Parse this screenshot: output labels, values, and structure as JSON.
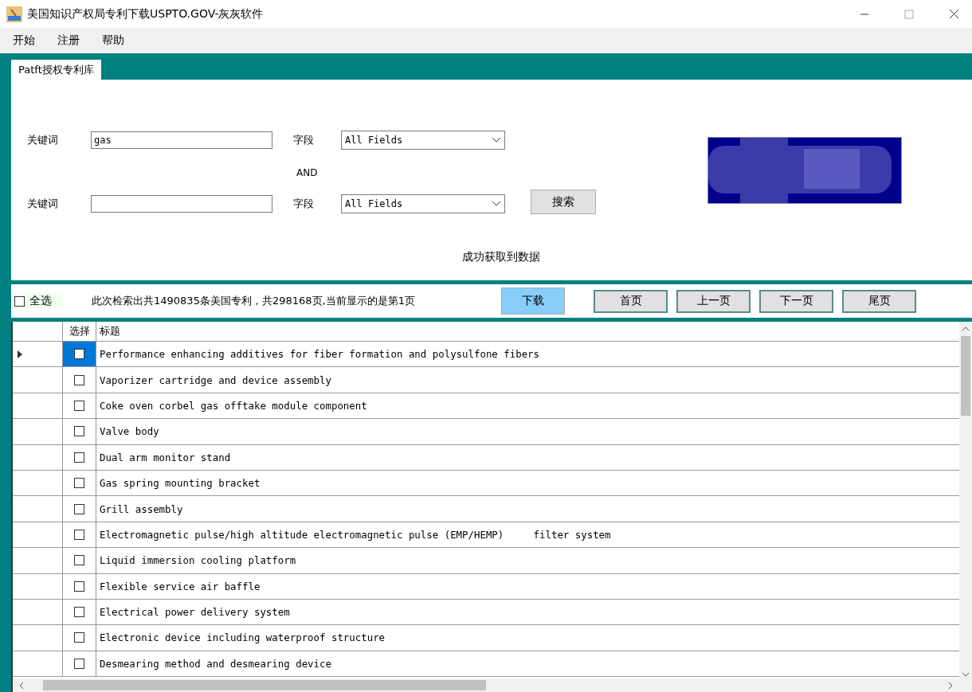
{
  "window": {
    "title": "美国知识产权局专利下载USPTO.GOV-灰灰软件"
  },
  "menu": [
    "开始",
    "注册",
    "帮助"
  ],
  "tabs": [
    {
      "label": "Patft授权专利库",
      "selected": true
    }
  ],
  "search": {
    "rows": [
      {
        "label": "关键词",
        "value": "gas",
        "field_label": "字段",
        "field": "All Fields"
      },
      {
        "label": "关键词",
        "field_label": "字段",
        "field": "All Fields"
      }
    ],
    "operator": "AND",
    "button": "搜索",
    "status": "成功获取到数据"
  },
  "toolbar": {
    "select_all": {
      "label": "全选",
      "checked": false
    },
    "summary": "此次检索出共1490835条美国专利，共298168页,当前显示的是第1页",
    "download": "下载",
    "pager": [
      "首页",
      "上一页",
      "下一页",
      "尾页"
    ]
  },
  "table": {
    "columns": [
      "选择",
      "标题"
    ],
    "rows": [
      {
        "title": "Performance enhancing additives for fiber formation and polysulfone fibers",
        "checked": false,
        "selected": true
      },
      {
        "title": "Vaporizer cartridge and device assembly",
        "checked": false,
        "selected": false
      },
      {
        "title": "Coke oven corbel gas offtake module component",
        "checked": false,
        "selected": false
      },
      {
        "title": "Valve body",
        "checked": false,
        "selected": false
      },
      {
        "title": "Dual arm monitor stand",
        "checked": false,
        "selected": false
      },
      {
        "title": "Gas spring mounting bracket",
        "checked": false,
        "selected": false
      },
      {
        "title": "Grill assembly",
        "checked": false,
        "selected": false
      },
      {
        "title": "Electromagnetic pulse/high altitude electromagnetic pulse (EMP/HEMP)     filter system",
        "checked": false,
        "selected": false
      },
      {
        "title": "Liquid immersion cooling platform",
        "checked": false,
        "selected": false
      },
      {
        "title": "Flexible service air baffle",
        "checked": false,
        "selected": false
      },
      {
        "title": "Electrical power delivery system",
        "checked": false,
        "selected": false
      },
      {
        "title": "Electronic device including waterproof structure",
        "checked": false,
        "selected": false
      },
      {
        "title": "Desmearing method and desmearing device",
        "checked": false,
        "selected": false
      }
    ]
  }
}
